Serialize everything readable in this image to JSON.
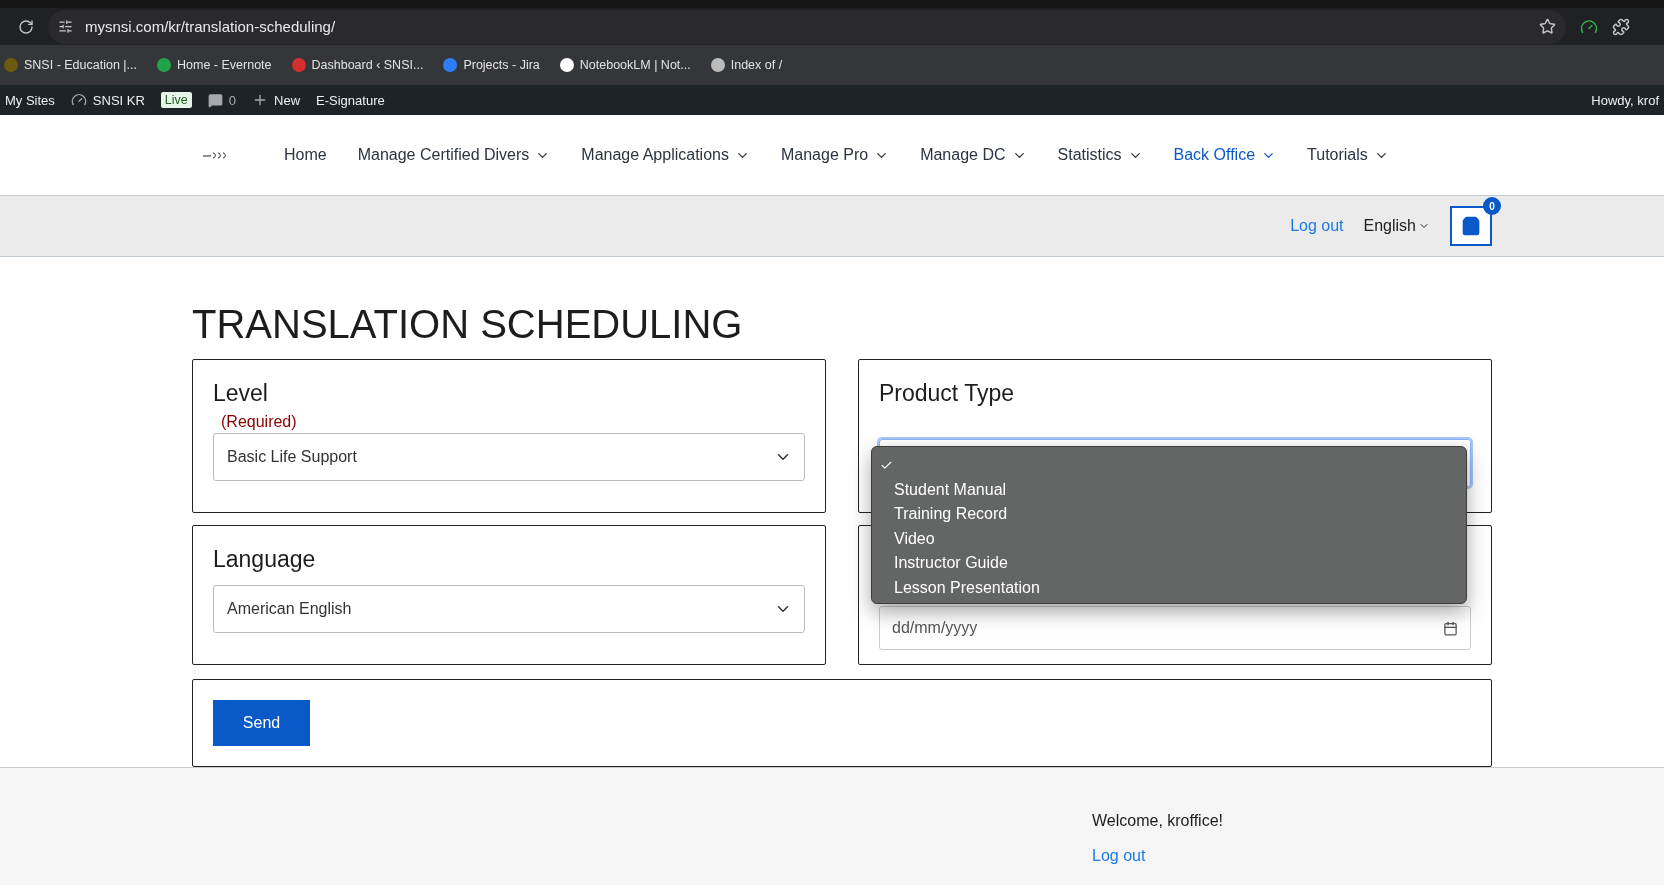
{
  "browser": {
    "url": "mysnsi.com/kr/translation-scheduling/",
    "bookmarks": [
      {
        "label": "SNSI - Education |..."
      },
      {
        "label": "Home - Evernote"
      },
      {
        "label": "Dashboard ‹ SNSI..."
      },
      {
        "label": "Projects - Jira"
      },
      {
        "label": "NotebookLM | Not..."
      },
      {
        "label": "Index of /"
      }
    ]
  },
  "admin_bar": {
    "my_sites": "My Sites",
    "site": "SNSI KR",
    "badge": "Live",
    "comments": "0",
    "new": "New",
    "esign": "E-Signature",
    "greeting": "Howdy, krof"
  },
  "nav": {
    "items": [
      {
        "label": "Home",
        "has_menu": false,
        "selected": false
      },
      {
        "label": "Manage Certified Divers",
        "has_menu": true,
        "selected": false
      },
      {
        "label": "Manage Applications",
        "has_menu": true,
        "selected": false
      },
      {
        "label": "Manage Pro",
        "has_menu": true,
        "selected": false
      },
      {
        "label": "Manage DC",
        "has_menu": true,
        "selected": false
      },
      {
        "label": "Statistics",
        "has_menu": true,
        "selected": false
      },
      {
        "label": "Back Office",
        "has_menu": true,
        "selected": true
      },
      {
        "label": "Tutorials",
        "has_menu": true,
        "selected": false
      }
    ]
  },
  "subbar": {
    "logout": "Log out",
    "language": "English",
    "cart_count": "0"
  },
  "page": {
    "title": "TRANSLATION SCHEDULING"
  },
  "form": {
    "level": {
      "label": "Level",
      "required": "(Required)",
      "value": "Basic Life Support"
    },
    "product_type": {
      "label": "Product Type",
      "focused": true,
      "options": [
        {
          "selected": true
        },
        {
          "label": "Student Manual",
          "selected": false
        },
        {
          "label": "Training Record",
          "selected": false
        },
        {
          "label": "Video",
          "selected": false
        },
        {
          "label": "Instructor Guide",
          "selected": false
        },
        {
          "label": "Lesson Presentation",
          "selected": false
        }
      ]
    },
    "language": {
      "label": "Language",
      "value": "American English"
    },
    "date": {
      "placeholder": "dd/mm/yyyy"
    },
    "submit": "Send"
  },
  "footer": {
    "welcome": "Welcome, kroffice!",
    "logout": "Log out"
  }
}
